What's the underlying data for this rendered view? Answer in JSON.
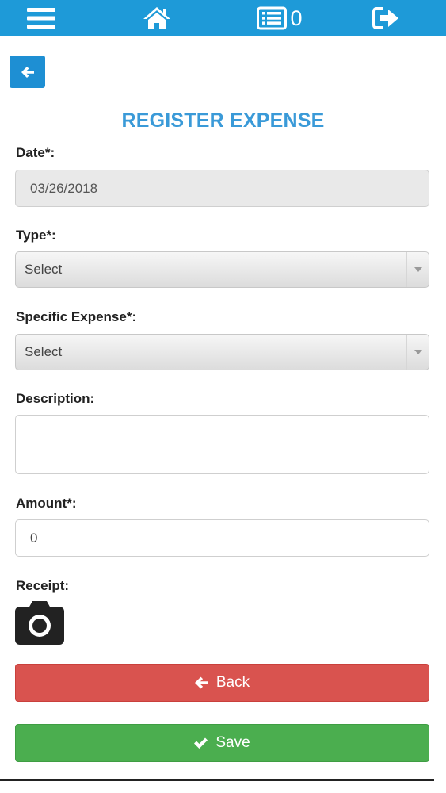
{
  "topbar": {
    "menu_icon": "hamburger-icon",
    "home_icon": "home-icon",
    "list_icon": "list-icon",
    "list_count": "0",
    "logout_icon": "logout-icon"
  },
  "form": {
    "title": "REGISTER EXPENSE",
    "back_icon": "arrow-left-icon",
    "date_label": "Date*:",
    "date_value": "03/26/2018",
    "type_label": "Type*:",
    "type_value": "Select",
    "specific_label": "Specific Expense*:",
    "specific_value": "Select",
    "description_label": "Description:",
    "description_value": "",
    "amount_label": "Amount*:",
    "amount_value": "0",
    "receipt_label": "Receipt:",
    "receipt_icon": "camera-icon"
  },
  "actions": {
    "back_label": "Back",
    "save_label": "Save"
  },
  "colors": {
    "topbar": "#1e9ad8",
    "title": "#3a9ad8",
    "back_button": "#d9534f",
    "save_button": "#4bae4f"
  }
}
